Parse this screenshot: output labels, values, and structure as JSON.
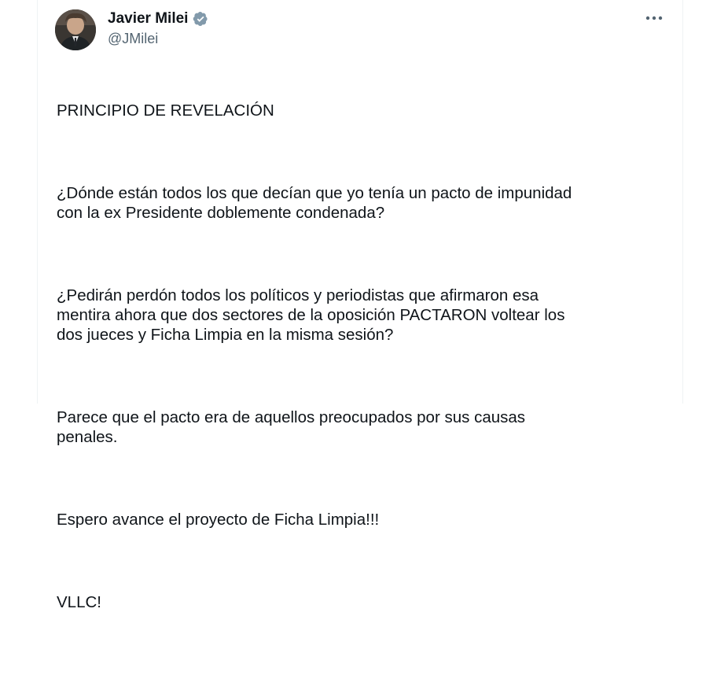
{
  "author": {
    "display_name": "Javier Milei",
    "handle": "@JMilei",
    "verified_icon": "verified-badge-icon",
    "verified_color": "#829aab"
  },
  "menu": {
    "icon": "more-horizontal-icon"
  },
  "tweet": {
    "paragraphs": [
      "PRINCIPIO DE REVELACIÓN",
      "¿Dónde están todos los que decían que yo tenía un pacto de impunidad\ncon la ex Presidente doblemente condenada?",
      "¿Pedirán perdón todos los políticos y periodistas que afirmaron esa\nmentira ahora que dos sectores de la oposición PACTARON voltear los\ndos jueces y Ficha Limpia en la misma sesión?",
      "Parece que el pacto era de aquellos preocupados por sus causas\npenales.",
      "Espero avance el proyecto de Ficha Limpia!!!",
      "VLLC!"
    ]
  }
}
